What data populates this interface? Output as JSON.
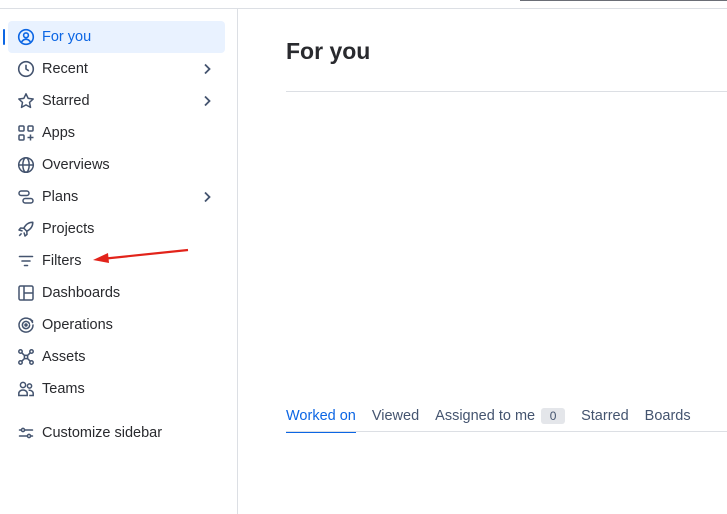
{
  "sidebar": {
    "items": [
      {
        "label": "For you",
        "icon": "person-circle-icon",
        "active": true,
        "chevron": false
      },
      {
        "label": "Recent",
        "icon": "clock-icon",
        "active": false,
        "chevron": true
      },
      {
        "label": "Starred",
        "icon": "star-icon",
        "active": false,
        "chevron": true
      },
      {
        "label": "Apps",
        "icon": "apps-grid-icon",
        "active": false,
        "chevron": false
      },
      {
        "label": "Overviews",
        "icon": "globe-icon",
        "active": false,
        "chevron": false
      },
      {
        "label": "Plans",
        "icon": "plans-icon",
        "active": false,
        "chevron": true
      },
      {
        "label": "Projects",
        "icon": "rocket-icon",
        "active": false,
        "chevron": false
      },
      {
        "label": "Filters",
        "icon": "filter-icon",
        "active": false,
        "chevron": false
      },
      {
        "label": "Dashboards",
        "icon": "dashboard-icon",
        "active": false,
        "chevron": false
      },
      {
        "label": "Operations",
        "icon": "operations-icon",
        "active": false,
        "chevron": false
      },
      {
        "label": "Assets",
        "icon": "assets-icon",
        "active": false,
        "chevron": false
      },
      {
        "label": "Teams",
        "icon": "teams-icon",
        "active": false,
        "chevron": false
      }
    ],
    "customize_label": "Customize sidebar"
  },
  "main": {
    "title": "For you",
    "tabs": [
      {
        "label": "Worked on",
        "active": true
      },
      {
        "label": "Viewed",
        "active": false
      },
      {
        "label": "Assigned to me",
        "active": false,
        "count": "0"
      },
      {
        "label": "Starred",
        "active": false
      },
      {
        "label": "Boards",
        "active": false
      }
    ]
  },
  "colors": {
    "accent": "#0c66e4",
    "active_bg": "#e9f2ff",
    "annotation_arrow": "#e2231a"
  }
}
